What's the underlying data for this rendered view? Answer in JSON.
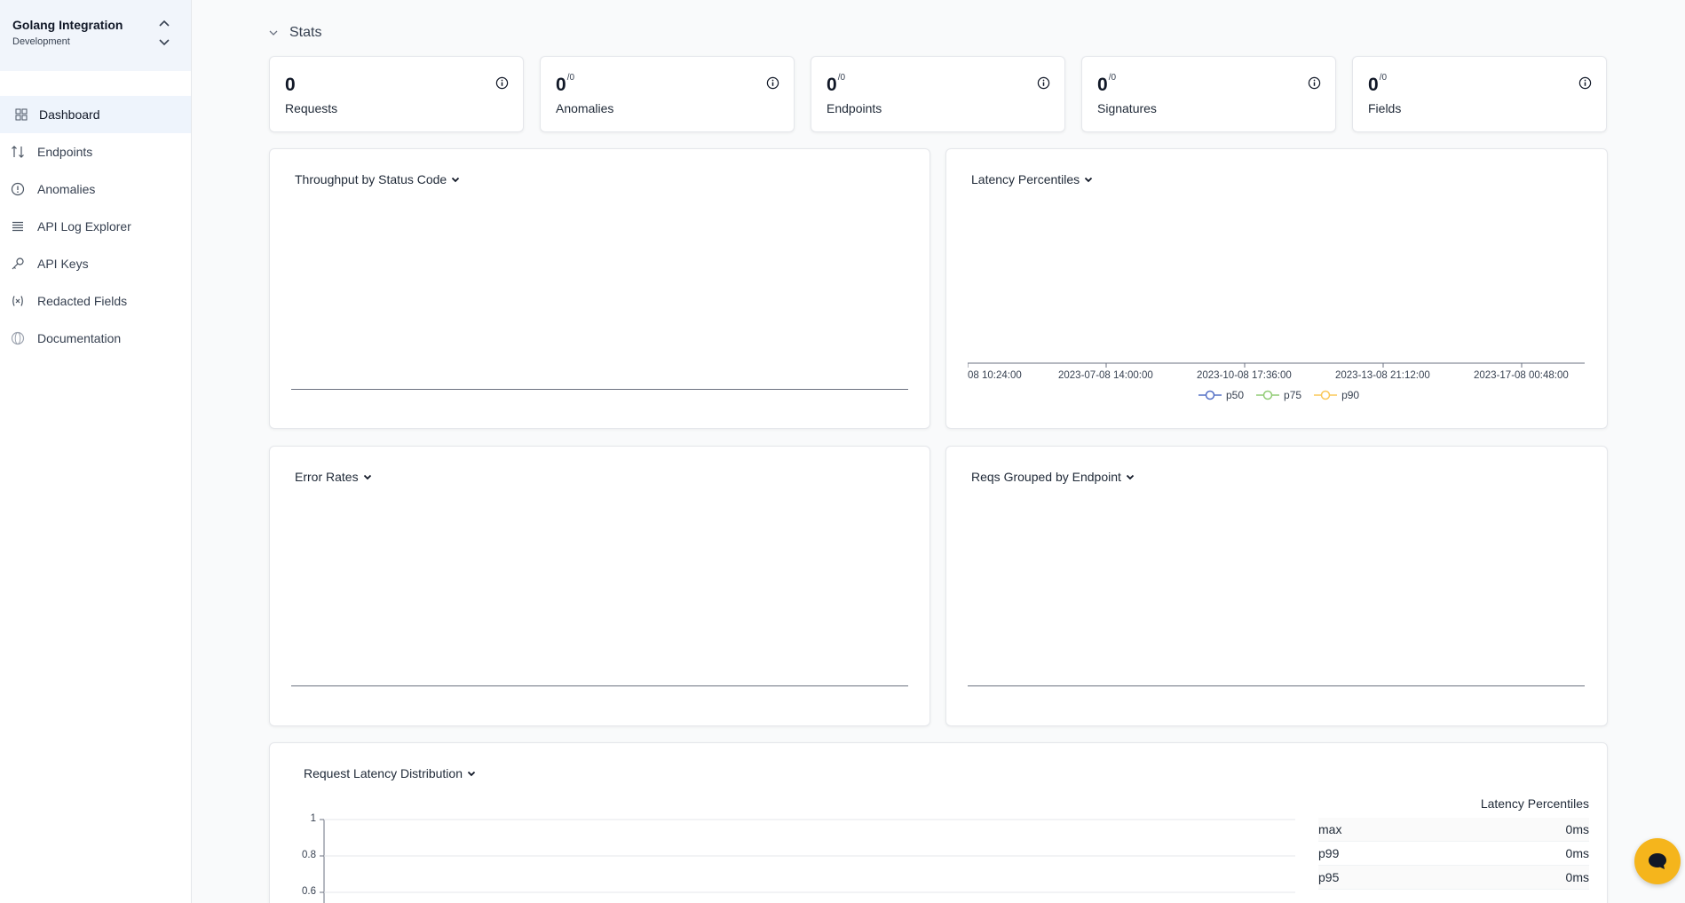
{
  "project": {
    "name": "Golang Integration",
    "environment": "Development"
  },
  "nav": [
    {
      "label": "Dashboard",
      "icon": "grid-icon",
      "active": true
    },
    {
      "label": "Endpoints",
      "icon": "arrows-up-down-icon",
      "active": false
    },
    {
      "label": "Anomalies",
      "icon": "alert-circle-icon",
      "active": false
    },
    {
      "label": "API Log Explorer",
      "icon": "list-icon",
      "active": false
    },
    {
      "label": "API Keys",
      "icon": "key-icon",
      "active": false
    },
    {
      "label": "Redacted Fields",
      "icon": "variable-icon",
      "active": false
    },
    {
      "label": "Documentation",
      "icon": "globe-icon",
      "active": false
    }
  ],
  "stats": {
    "section_title": "Stats",
    "cards": [
      {
        "value": "0",
        "suffix": "",
        "label": "Requests"
      },
      {
        "value": "0",
        "suffix": "/0",
        "label": "Anomalies"
      },
      {
        "value": "0",
        "suffix": "/0",
        "label": "Endpoints"
      },
      {
        "value": "0",
        "suffix": "/0",
        "label": "Signatures"
      },
      {
        "value": "0",
        "suffix": "/0",
        "label": "Fields"
      }
    ]
  },
  "charts": {
    "throughput": {
      "title": "Throughput by Status Code"
    },
    "latency": {
      "title": "Latency Percentiles",
      "x_ticks": [
        "08 10:24:00",
        "2023-07-08 14:00:00",
        "2023-10-08 17:36:00",
        "2023-13-08 21:12:00",
        "2023-17-08 00:48:00"
      ],
      "legend": [
        {
          "name": "p50",
          "color": "#5470c6"
        },
        {
          "name": "p75",
          "color": "#91cc75"
        },
        {
          "name": "p90",
          "color": "#fac858"
        }
      ]
    },
    "errors": {
      "title": "Error Rates"
    },
    "reqs_by_endpoint": {
      "title": "Reqs Grouped by Endpoint"
    },
    "latency_distribution": {
      "title": "Request Latency Distribution",
      "y_ticks": [
        "1",
        "0.8",
        "0.6"
      ],
      "table_title": "Latency Percentiles",
      "rows": [
        {
          "label": "max",
          "value": "0ms"
        },
        {
          "label": "p99",
          "value": "0ms"
        },
        {
          "label": "p95",
          "value": "0ms"
        }
      ]
    }
  },
  "chart_data": {
    "type": "line",
    "title": "Latency Percentiles",
    "x": [
      "08 10:24:00",
      "2023-07-08 14:00:00",
      "2023-10-08 17:36:00",
      "2023-13-08 21:12:00",
      "2023-17-08 00:48:00"
    ],
    "series": [
      {
        "name": "p50",
        "values": []
      },
      {
        "name": "p75",
        "values": []
      },
      {
        "name": "p90",
        "values": []
      }
    ],
    "legend": "bottom-center",
    "grid": false
  }
}
